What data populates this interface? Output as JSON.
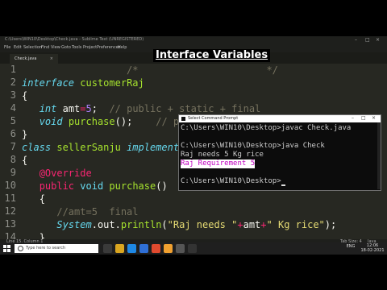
{
  "editor": {
    "window_title": "C:\\Users\\WIN10\\Desktop\\Check.java - Sublime Text (UNREGISTERED)",
    "menu": [
      "File",
      "Edit",
      "Selection",
      "Find",
      "View",
      "Goto",
      "Tools",
      "Project",
      "Preferences",
      "Help"
    ],
    "tab_label": "Check.java",
    "tab_close": "×",
    "overlay_heading": "Interface Variables",
    "line_numbers": [
      "1",
      "2",
      "3",
      "4",
      "5",
      "6",
      "7",
      "8",
      "9",
      "10",
      "11",
      "12",
      "13",
      "14"
    ],
    "status_left": "Line 15, Column 1",
    "status_tab": "Tab Size: 4",
    "status_lang": "Java"
  },
  "code": {
    "l1_cm1": "/*",
    "l1_cm2": "*/",
    "l2_kw": "interface",
    "l2_name": "customerRaj",
    "l3": "{",
    "l4_type": "int",
    "l4_var": " amt",
    "l4_eq": "=",
    "l4_num": "5",
    "l4_semi": ";",
    "l4_cm": "// public + static + final",
    "l5_type": "void",
    "l5_fn": "purchase",
    "l5_rest": "();",
    "l5_cm": "// public + abstract",
    "l6": "}",
    "l7_kw": "class",
    "l7_name": "sellerSanju",
    "l7_impl": "implements",
    "l8": "{",
    "l9_ann": "@Override",
    "l10_mod": "public",
    "l10_void": "void",
    "l10_fn": "purchase",
    "l10_rest": "()",
    "l11": "{",
    "l12_cm": "//amt=5  final",
    "l13_sys": "System",
    "l13_out": ".out.",
    "l13_fn": "println",
    "l13_p": "(",
    "l13_s1": "\"Raj needs \"",
    "l13_plus1": "+",
    "l13_amt": "amt",
    "l13_plus2": "+",
    "l13_s2": "\" Kg rice\"",
    "l13_end": ");",
    "l14": "}"
  },
  "cmd": {
    "title": "Select Command Prompt",
    "minimize": "–",
    "maximize": "□",
    "close": "×",
    "lines": [
      "C:\\Users\\WIN10\\Desktop>javac Check.java",
      "",
      "C:\\Users\\WIN10\\Desktop>java Check",
      "Raj needs 5 Kg rice",
      "Raj Requirement 5",
      "",
      "C:\\Users\\WIN10\\Desktop>"
    ],
    "highlight_color": "#c000c0"
  },
  "taskbar": {
    "search_placeholder": "Type here to search",
    "time": "12:06",
    "date": "18-02-2021",
    "lang": "ENG"
  }
}
